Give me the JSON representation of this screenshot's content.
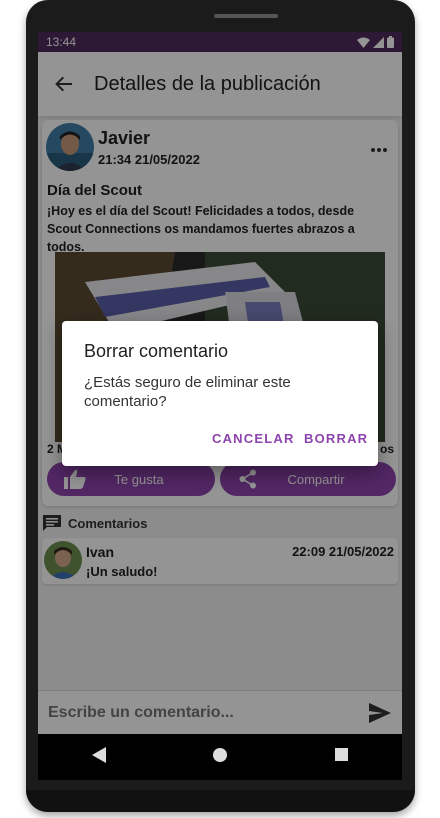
{
  "status": {
    "time": "13:44"
  },
  "appbar": {
    "title": "Detalles de la publicación"
  },
  "post": {
    "author": "Javier",
    "date": "21:34 21/05/2022",
    "title": "Día del Scout",
    "body": "¡Hoy es el día del Scout! Felicidades a todos, desde Scout Connections os mandamos fuertes abrazos a todos.",
    "likes_count": "2 M",
    "shares_count": "os",
    "like_label": "Te gusta",
    "share_label": "Compartir"
  },
  "comments": {
    "header": "Comentarios",
    "items": [
      {
        "author": "Ivan",
        "date": "22:09 21/05/2022",
        "text": "¡Un saludo!"
      }
    ]
  },
  "input": {
    "placeholder": "Escribe un comentario..."
  },
  "dialog": {
    "title": "Borrar comentario",
    "message": "¿Estás seguro de eliminar este comentario?",
    "cancel": "CANCELAR",
    "confirm": "BORRAR"
  },
  "colors": {
    "accent": "#8e44ad",
    "statusbar": "#4e2a5e"
  },
  "icons": [
    "back-arrow-icon",
    "more-vert-icon",
    "thumb-up-icon",
    "share-icon",
    "comment-icon",
    "send-icon",
    "wifi-icon",
    "signal-icon",
    "battery-icon",
    "nav-back-icon",
    "nav-home-icon",
    "nav-recents-icon"
  ]
}
